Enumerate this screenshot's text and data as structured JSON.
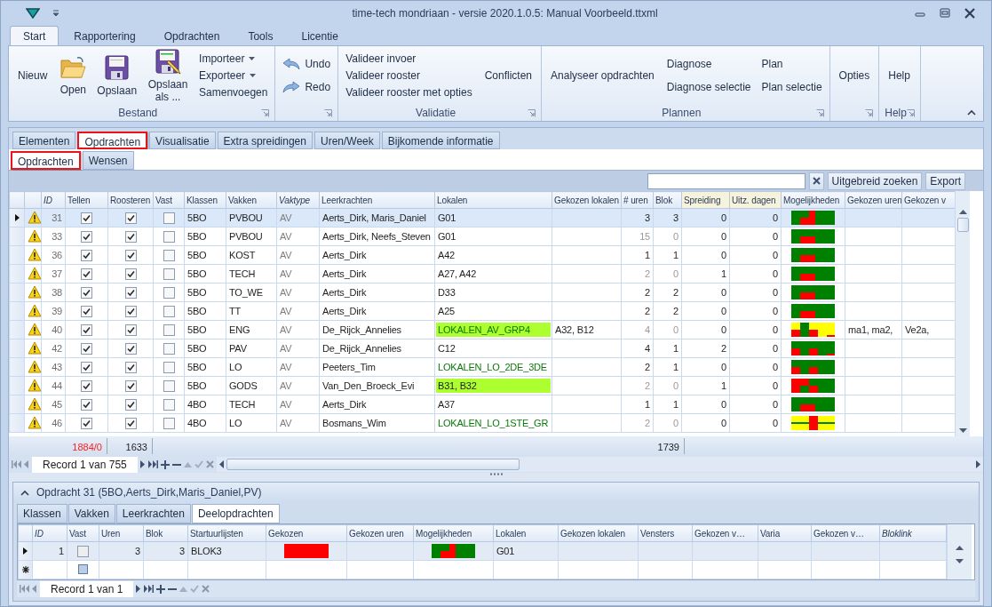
{
  "window": {
    "title": "time-tech mondriaan - versie 2020.1.0.5: Manual Voorbeeld.ttxml"
  },
  "ribbon": {
    "tabs": [
      {
        "label": "Start",
        "selected": true
      },
      {
        "label": "Rapportering",
        "selected": false
      },
      {
        "label": "Opdrachten",
        "selected": false
      },
      {
        "label": "Tools",
        "selected": false
      },
      {
        "label": "Licentie",
        "selected": false
      }
    ],
    "groups": [
      {
        "label": "Bestand",
        "launcher": true,
        "columns": [
          [
            {
              "kind": "text",
              "label": "Nieuw"
            }
          ],
          [
            {
              "kind": "folder",
              "label": "Open"
            }
          ],
          [
            {
              "kind": "disk",
              "label": "Opslaan"
            }
          ],
          [
            {
              "kind": "disk-edit",
              "label": "Opslaan als ..."
            }
          ],
          [
            {
              "kind": "dropdown",
              "label": "Importeer"
            },
            {
              "kind": "dropdown",
              "label": "Exporteer"
            },
            {
              "kind": "small",
              "label": "Samenvoegen"
            }
          ]
        ]
      },
      {
        "launcher": true,
        "columns": [
          [
            {
              "kind": "undo",
              "label": "Undo"
            },
            {
              "kind": "redo",
              "label": "Redo"
            }
          ]
        ]
      },
      {
        "label": "Validatie",
        "launcher": true,
        "columns": [
          [
            {
              "kind": "small",
              "label": "Valideer invoer"
            },
            {
              "kind": "small",
              "label": "Valideer rooster"
            },
            {
              "kind": "small",
              "label": "Valideer rooster met opties"
            }
          ],
          [
            {
              "kind": "text",
              "label": "Conflicten"
            }
          ]
        ]
      },
      {
        "label": "Plannen",
        "launcher": true,
        "columns": [
          [
            {
              "kind": "text",
              "label": "Analyseer opdrachten"
            }
          ],
          [
            {
              "kind": "small",
              "label": "Diagnose"
            },
            {
              "kind": "small",
              "label": "Diagnose selectie"
            }
          ],
          [
            {
              "kind": "small",
              "label": "Plan"
            },
            {
              "kind": "small",
              "label": "Plan selectie"
            }
          ]
        ]
      },
      {
        "launcher": true,
        "columns": [
          [
            {
              "kind": "text",
              "label": "Opties"
            }
          ]
        ]
      },
      {
        "label": "Help",
        "launcher": true,
        "columns": [
          [
            {
              "kind": "text",
              "label": "Help"
            }
          ]
        ]
      }
    ]
  },
  "tabs": [
    {
      "label": "Elementen",
      "selected": false,
      "marked": false
    },
    {
      "label": "Opdrachten",
      "selected": true,
      "marked": true
    },
    {
      "label": "Visualisatie",
      "selected": false,
      "marked": false
    },
    {
      "label": "Extra spreidingen",
      "selected": false,
      "marked": false
    },
    {
      "label": "Uren/Week",
      "selected": false,
      "marked": false
    },
    {
      "label": "Bijkomende informatie",
      "selected": false,
      "marked": false
    }
  ],
  "subtabs": [
    {
      "label": "Opdrachten",
      "selected": true,
      "marked": true
    },
    {
      "label": "Wensen",
      "selected": false,
      "marked": false
    }
  ],
  "toolbar": {
    "search_button": "Uitgebreid zoeken",
    "export_button": "Export"
  },
  "grid": {
    "columns": [
      {
        "label": "ID",
        "italic": true,
        "highlighted": false
      },
      {
        "label": "Tellen",
        "italic": false,
        "highlighted": false
      },
      {
        "label": "Roosteren",
        "italic": false,
        "highlighted": false
      },
      {
        "label": "Vast",
        "italic": false,
        "highlighted": false
      },
      {
        "label": "Klassen",
        "italic": false,
        "highlighted": false
      },
      {
        "label": "Vakken",
        "italic": false,
        "highlighted": false
      },
      {
        "label": "Vaktype",
        "italic": true,
        "highlighted": false
      },
      {
        "label": "Leerkrachten",
        "italic": false,
        "highlighted": false
      },
      {
        "label": "Lokalen",
        "italic": false,
        "highlighted": false
      },
      {
        "label": "Gekozen lokalen",
        "italic": false,
        "highlighted": false
      },
      {
        "label": "# uren",
        "italic": false,
        "highlighted": false
      },
      {
        "label": "Blok",
        "italic": false,
        "highlighted": false
      },
      {
        "label": "Spreiding",
        "italic": false,
        "highlighted": true
      },
      {
        "label": "Uitz. dagen",
        "italic": false,
        "highlighted": true
      },
      {
        "label": "Mogelijkheden",
        "italic": false,
        "highlighted": false
      },
      {
        "label": "Gekozen uren",
        "italic": false,
        "highlighted": false
      },
      {
        "label": "Gekozen v",
        "italic": false,
        "highlighted": false
      }
    ],
    "rows": [
      {
        "selected": true,
        "warning": true,
        "id": "31",
        "tellen": true,
        "roosteren": true,
        "vast": false,
        "klassen": "5BO",
        "vakken": "PVBOU",
        "vaktype": "AV",
        "leerkrachten": "Aerts_Dirk, Maris_Daniel",
        "lokalen": {
          "text": "G01",
          "kind": "plain"
        },
        "uren": "3",
        "blok": "3",
        "dimmed": false,
        "spreiding": "0",
        "uitz_dagen": "0",
        "mogelijkheden": {
          "kind": "step"
        }
      },
      {
        "selected": false,
        "warning": true,
        "id": "33",
        "tellen": true,
        "roosteren": true,
        "vast": false,
        "klassen": "5BO",
        "vakken": "PVBOU",
        "vaktype": "AV",
        "leerkrachten": "Aerts_Dirk, Neefs_Steven",
        "lokalen": {
          "text": "G01",
          "kind": "plain"
        },
        "uren": "15",
        "blok": "0",
        "dimmed": true,
        "spreiding": "0",
        "uitz_dagen": "0",
        "mogelijkheden": {
          "kind": "block"
        }
      },
      {
        "selected": false,
        "warning": true,
        "id": "36",
        "tellen": true,
        "roosteren": true,
        "vast": false,
        "klassen": "5BO",
        "vakken": "KOST",
        "vaktype": "AV",
        "leerkrachten": "Aerts_Dirk",
        "lokalen": {
          "text": "A42",
          "kind": "plain"
        },
        "uren": "1",
        "blok": "1",
        "dimmed": false,
        "spreiding": "0",
        "uitz_dagen": "0",
        "mogelijkheden": {
          "kind": "block"
        }
      },
      {
        "selected": false,
        "warning": true,
        "id": "37",
        "tellen": true,
        "roosteren": true,
        "vast": false,
        "klassen": "5BO",
        "vakken": "TECH",
        "vaktype": "AV",
        "leerkrachten": "Aerts_Dirk",
        "lokalen": {
          "text": "A27, A42",
          "kind": "plain"
        },
        "uren": "2",
        "blok": "0",
        "dimmed": true,
        "spreiding": "1",
        "uitz_dagen": "0",
        "mogelijkheden": {
          "kind": "block"
        }
      },
      {
        "selected": false,
        "warning": true,
        "id": "38",
        "tellen": true,
        "roosteren": true,
        "vast": false,
        "klassen": "5BO",
        "vakken": "TO_WE",
        "vaktype": "AV",
        "leerkrachten": "Aerts_Dirk",
        "lokalen": {
          "text": "D33",
          "kind": "plain"
        },
        "uren": "2",
        "blok": "2",
        "dimmed": false,
        "spreiding": "0",
        "uitz_dagen": "0",
        "mogelijkheden": {
          "kind": "block"
        }
      },
      {
        "selected": false,
        "warning": true,
        "id": "39",
        "tellen": true,
        "roosteren": true,
        "vast": false,
        "klassen": "5BO",
        "vakken": "TT",
        "vaktype": "AV",
        "leerkrachten": "Aerts_Dirk",
        "lokalen": {
          "text": "A25",
          "kind": "plain"
        },
        "uren": "2",
        "blok": "2",
        "dimmed": false,
        "spreiding": "0",
        "uitz_dagen": "0",
        "mogelijkheden": {
          "kind": "block"
        }
      },
      {
        "selected": false,
        "warning": true,
        "id": "40",
        "tellen": true,
        "roosteren": true,
        "vast": false,
        "klassen": "5BO",
        "vakken": "ENG",
        "vaktype": "AV",
        "leerkrachten": "De_Rijck_Annelies",
        "lokalen": {
          "text": "LOKALEN_AV_GRP4",
          "kind": "highlight-group"
        },
        "gekozen_lokalen": "A32, B12",
        "uren": "4",
        "blok": "0",
        "dimmed": true,
        "spreiding": "0",
        "uitz_dagen": "0",
        "mogelijkheden": {
          "kind": "yellow-mix"
        },
        "gekozen_uren": "ma1, ma2,",
        "gekozen_v": "Ve2a,"
      },
      {
        "selected": false,
        "warning": true,
        "id": "42",
        "tellen": true,
        "roosteren": true,
        "vast": false,
        "klassen": "5BO",
        "vakken": "PAV",
        "vaktype": "AV",
        "leerkrachten": "De_Rijck_Annelies",
        "lokalen": {
          "text": "C12",
          "kind": "plain"
        },
        "uren": "4",
        "blok": "1",
        "dimmed": false,
        "spreiding": "2",
        "uitz_dagen": "0",
        "mogelijkheden": {
          "kind": "mix"
        }
      },
      {
        "selected": false,
        "warning": true,
        "id": "43",
        "tellen": true,
        "roosteren": true,
        "vast": false,
        "klassen": "5BO",
        "vakken": "LO",
        "vaktype": "AV",
        "leerkrachten": "Peeters_Tim",
        "lokalen": {
          "text": "LOKALEN_LO_2DE_3DE",
          "kind": "group"
        },
        "uren": "2",
        "blok": "1",
        "dimmed": false,
        "spreiding": "0",
        "uitz_dagen": "0",
        "mogelijkheden": {
          "kind": "mix-plain"
        }
      },
      {
        "selected": false,
        "warning": true,
        "id": "44",
        "tellen": true,
        "roosteren": true,
        "vast": false,
        "klassen": "5BO",
        "vakken": "GODS",
        "vaktype": "AV",
        "leerkrachten": "Van_Den_Broeck_Evi",
        "lokalen": {
          "text": "B31, B32",
          "kind": "highlight"
        },
        "uren": "2",
        "blok": "0",
        "dimmed": true,
        "spreiding": "1",
        "uitz_dagen": "0",
        "mogelijkheden": {
          "kind": "red-left"
        }
      },
      {
        "selected": false,
        "warning": true,
        "id": "45",
        "tellen": true,
        "roosteren": true,
        "vast": false,
        "klassen": "4BO",
        "vakken": "TECH",
        "vaktype": "AV",
        "leerkrachten": "Aerts_Dirk",
        "lokalen": {
          "text": "A37",
          "kind": "plain"
        },
        "uren": "1",
        "blok": "1",
        "dimmed": false,
        "spreiding": "0",
        "uitz_dagen": "0",
        "mogelijkheden": {
          "kind": "block"
        }
      },
      {
        "selected": false,
        "warning": true,
        "id": "46",
        "tellen": true,
        "roosteren": true,
        "vast": false,
        "klassen": "4BO",
        "vakken": "LO",
        "vaktype": "AV",
        "leerkrachten": "Bosmans_Wim",
        "lokalen": {
          "text": "LOKALEN_LO_1STE_GR",
          "kind": "group"
        },
        "uren": "2",
        "blok": "0",
        "dimmed": true,
        "spreiding": "0",
        "uitz_dagen": "0",
        "mogelijkheden": {
          "kind": "yellow-bar"
        }
      }
    ],
    "sums": {
      "tellen": "1884/0",
      "tellen_error": true,
      "roosteren": "1633",
      "uren": "1739"
    },
    "navigator": "Record 1 van 755"
  },
  "detail": {
    "title": "Opdracht 31 (5BO,Aerts_Dirk,Maris_Daniel,PV)",
    "expanded": true,
    "tabs": [
      {
        "label": "Klassen",
        "selected": false
      },
      {
        "label": "Vakken",
        "selected": false
      },
      {
        "label": "Leerkrachten",
        "selected": false
      },
      {
        "label": "Deelopdrachten",
        "selected": true
      }
    ],
    "columns": [
      {
        "label": "ID",
        "italic": true
      },
      {
        "label": "Vast",
        "italic": false
      },
      {
        "label": "Uren",
        "italic": false
      },
      {
        "label": "Blok",
        "italic": false
      },
      {
        "label": "Startuurlijsten",
        "italic": false
      },
      {
        "label": "Gekozen",
        "italic": false
      },
      {
        "label": "Gekozen uren",
        "italic": false
      },
      {
        "label": "Mogelijkheden",
        "italic": false
      },
      {
        "label": "Lokalen",
        "italic": false
      },
      {
        "label": "Gekozen lokalen",
        "italic": false
      },
      {
        "label": "Vensters",
        "italic": false
      },
      {
        "label": "Gekozen v…",
        "italic": false
      },
      {
        "label": "Varia",
        "italic": false
      },
      {
        "label": "Gekozen v…",
        "italic": false
      },
      {
        "label": "Bloklink",
        "italic": true
      }
    ],
    "rows": [
      {
        "selected": true,
        "id": "1",
        "vast": false,
        "uren": "3",
        "blok": "3",
        "startuurlijsten": "BLOK3",
        "gekozen": {
          "kind": "full"
        },
        "mogelijkheden": {
          "kind": "step"
        },
        "lokalen": "G01"
      }
    ],
    "new_row": {
      "vast": false
    },
    "navigator": "Record 1 van 1"
  }
}
